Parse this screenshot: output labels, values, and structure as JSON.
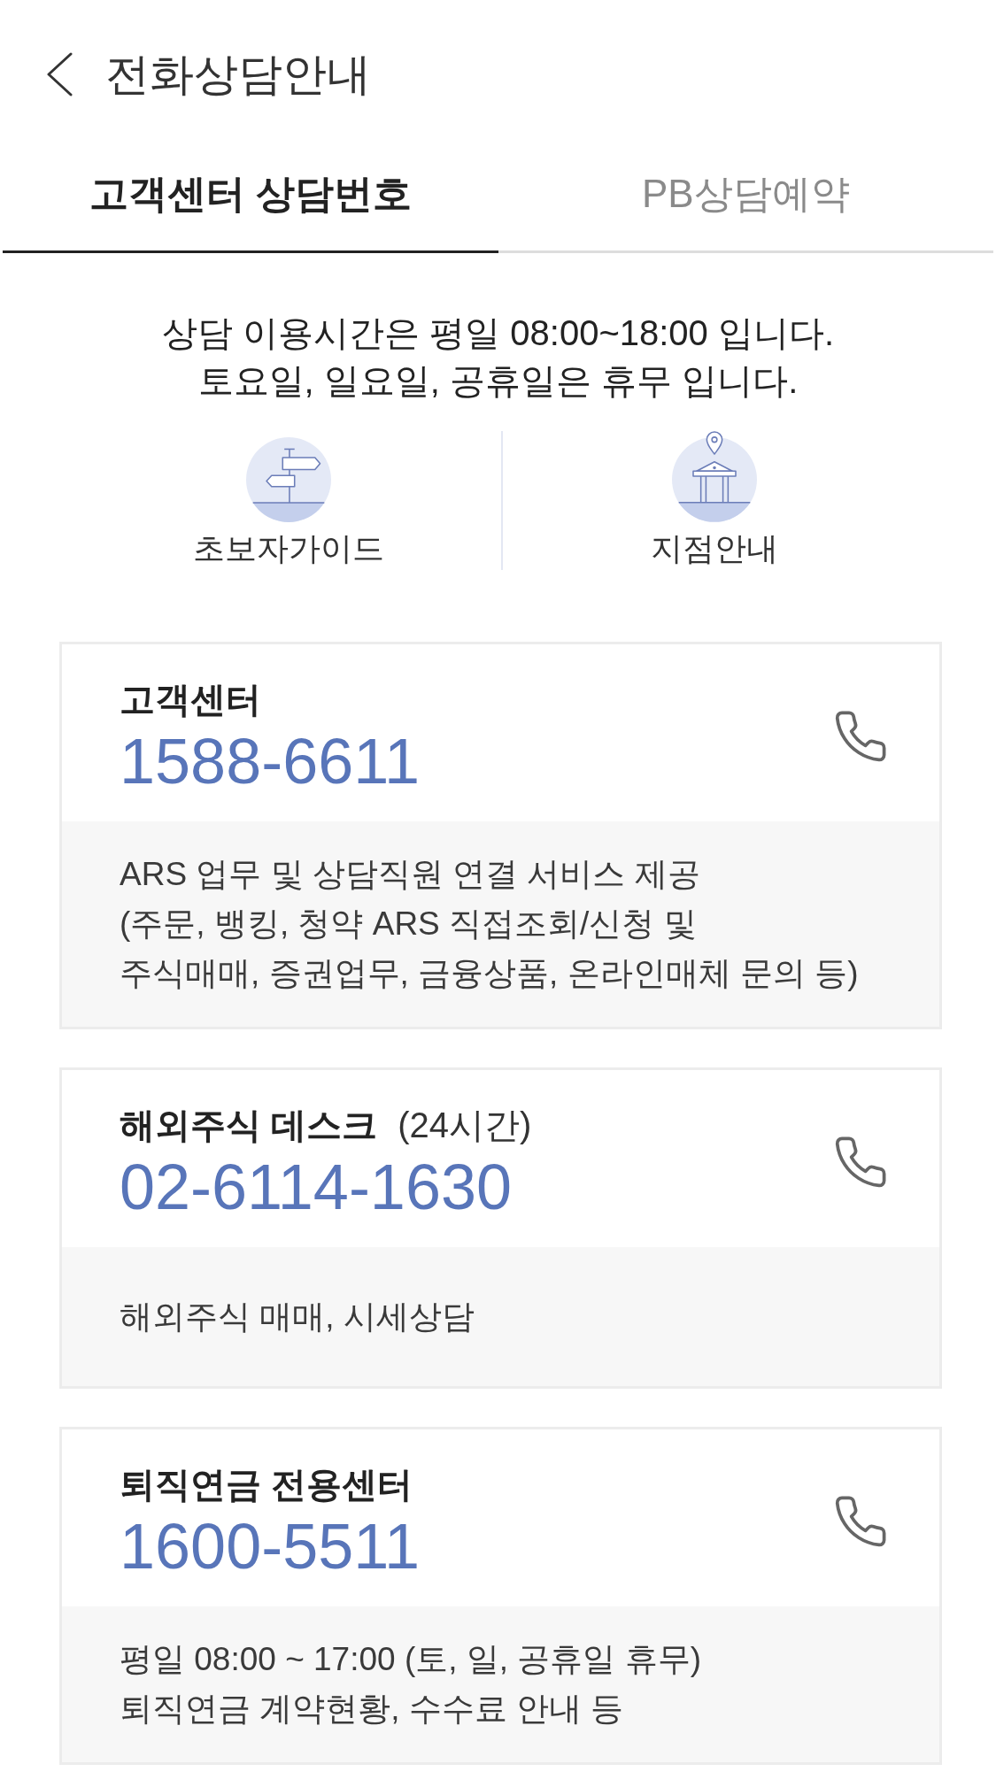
{
  "header": {
    "title": "전화상담안내"
  },
  "tabs": [
    {
      "label": "고객센터 상담번호",
      "selected": true
    },
    {
      "label": "PB상담예약",
      "selected": false
    }
  ],
  "notice": [
    "상담 이용시간은 평일 08:00~18:00 입니다.",
    "토요일, 일요일, 공휴일은 휴무 입니다."
  ],
  "shortcuts": [
    {
      "kind": "signpost",
      "label": "초보자가이드"
    },
    {
      "kind": "branch",
      "label": "지점안내"
    }
  ],
  "contacts": [
    {
      "name": "고객센터",
      "phone": "1588-6611",
      "description": [
        "ARS 업무 및 상담직원 연결 서비스 제공",
        "(주문, 뱅킹, 청약 ARS 직접조회/신청 및",
        "주식매매, 증권업무, 금융상품, 온라인매체 문의 등)"
      ]
    },
    {
      "name": "해외주식 데스크",
      "note": "(24시간)",
      "phone": "02-6114-1630",
      "description": [
        "해외주식 매매, 시세상담"
      ]
    },
    {
      "name": "퇴직연금 전용센터",
      "phone": "1600-5511",
      "description": [
        "평일 08:00 ~ 17:00 (토, 일, 공휴일 휴무)",
        "퇴직연금 계약현황, 수수료 안내 등"
      ]
    }
  ]
}
